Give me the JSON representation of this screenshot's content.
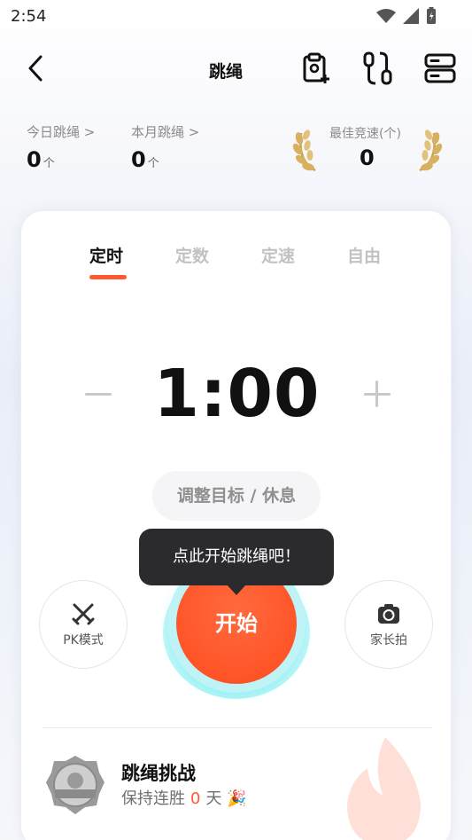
{
  "status": {
    "time": "2:54"
  },
  "nav": {
    "title": "跳绳"
  },
  "stats": {
    "today_label": "今日跳绳",
    "today_value": "0",
    "today_unit": "个",
    "month_label": "本月跳绳",
    "month_value": "0",
    "month_unit": "个",
    "best_label": "最佳竞速(个)",
    "best_value": "0"
  },
  "tabs": [
    {
      "label": "定时"
    },
    {
      "label": "定数"
    },
    {
      "label": "定速"
    },
    {
      "label": "自由"
    }
  ],
  "timer": {
    "value": "1:00"
  },
  "adjust_label": "调整目标 / 休息",
  "tooltip": "点此开始跳绳吧！",
  "start_label": "开始",
  "pk_label": "PK模式",
  "parent_label": "家长拍",
  "challenge": {
    "title": "跳绳挑战",
    "sub_prefix": "保持连胜",
    "streak": "0",
    "sub_suffix": "天",
    "emoji": "🎉"
  },
  "colors": {
    "accent": "#ff5a2f",
    "ring": "#9ff2f6",
    "tooltip_bg": "#2b2b2e"
  }
}
